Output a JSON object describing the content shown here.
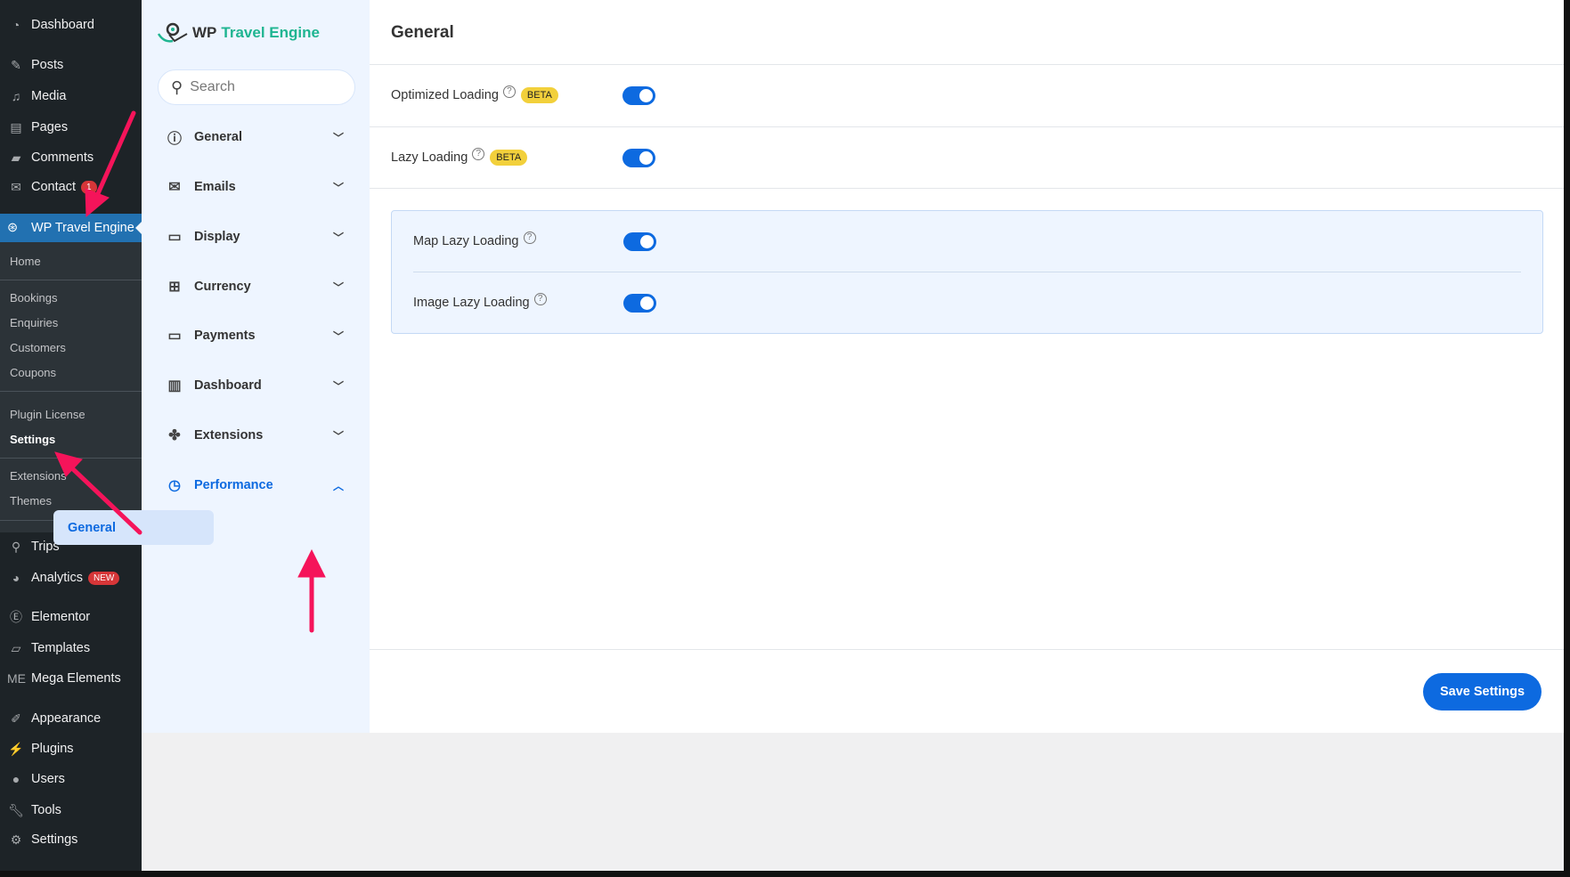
{
  "wp_menu": {
    "top": [
      {
        "label": "Dashboard",
        "icon": "dashboard-icon"
      },
      {
        "label": "Posts",
        "icon": "pin-icon"
      },
      {
        "label": "Media",
        "icon": "media-icon"
      },
      {
        "label": "Pages",
        "icon": "pages-icon"
      },
      {
        "label": "Comments",
        "icon": "comment-icon"
      },
      {
        "label": "Contact",
        "icon": "mail-icon",
        "badge": "1"
      }
    ],
    "active": "WP Travel Engine",
    "submenu": [
      "Home",
      "Bookings",
      "Enquiries",
      "Customers",
      "Coupons",
      "Plugin License",
      "Settings",
      "Extensions",
      "Themes"
    ],
    "bottom": [
      {
        "label": "Trips",
        "icon": "hikers-icon"
      },
      {
        "label": "Analytics",
        "icon": "pie-chart-icon",
        "badge": "NEW"
      },
      {
        "label": "Elementor",
        "icon": "elementor-icon"
      },
      {
        "label": "Templates",
        "icon": "folder-icon"
      },
      {
        "label": "Mega Elements",
        "icon": "mega-elements-icon"
      },
      {
        "label": "Appearance",
        "icon": "brush-icon"
      },
      {
        "label": "Plugins",
        "icon": "plugin-icon"
      },
      {
        "label": "Users",
        "icon": "user-icon"
      },
      {
        "label": "Tools",
        "icon": "wrench-icon"
      },
      {
        "label": "Settings",
        "icon": "settings-icon"
      }
    ]
  },
  "plugin": {
    "logo_a": "WP",
    "logo_b": "Travel Engine",
    "search_placeholder": "Search",
    "nav": [
      "General",
      "Emails",
      "Display",
      "Currency",
      "Payments",
      "Dashboard",
      "Extensions",
      "Performance"
    ],
    "sub": "General"
  },
  "main": {
    "title": "General",
    "rows": [
      {
        "label": "Optimized Loading",
        "badge": "BETA",
        "on": true
      },
      {
        "label": "Lazy Loading",
        "badge": "BETA",
        "on": true
      }
    ],
    "group": [
      {
        "label": "Map Lazy Loading",
        "on": true
      },
      {
        "label": "Image Lazy Loading",
        "on": true
      }
    ],
    "save": "Save Settings"
  },
  "colors": {
    "accent": "#0d6ae0",
    "wp_active": "#2271b1",
    "annotation_arrow": "#f5145a",
    "beta": "#f2d03b"
  }
}
